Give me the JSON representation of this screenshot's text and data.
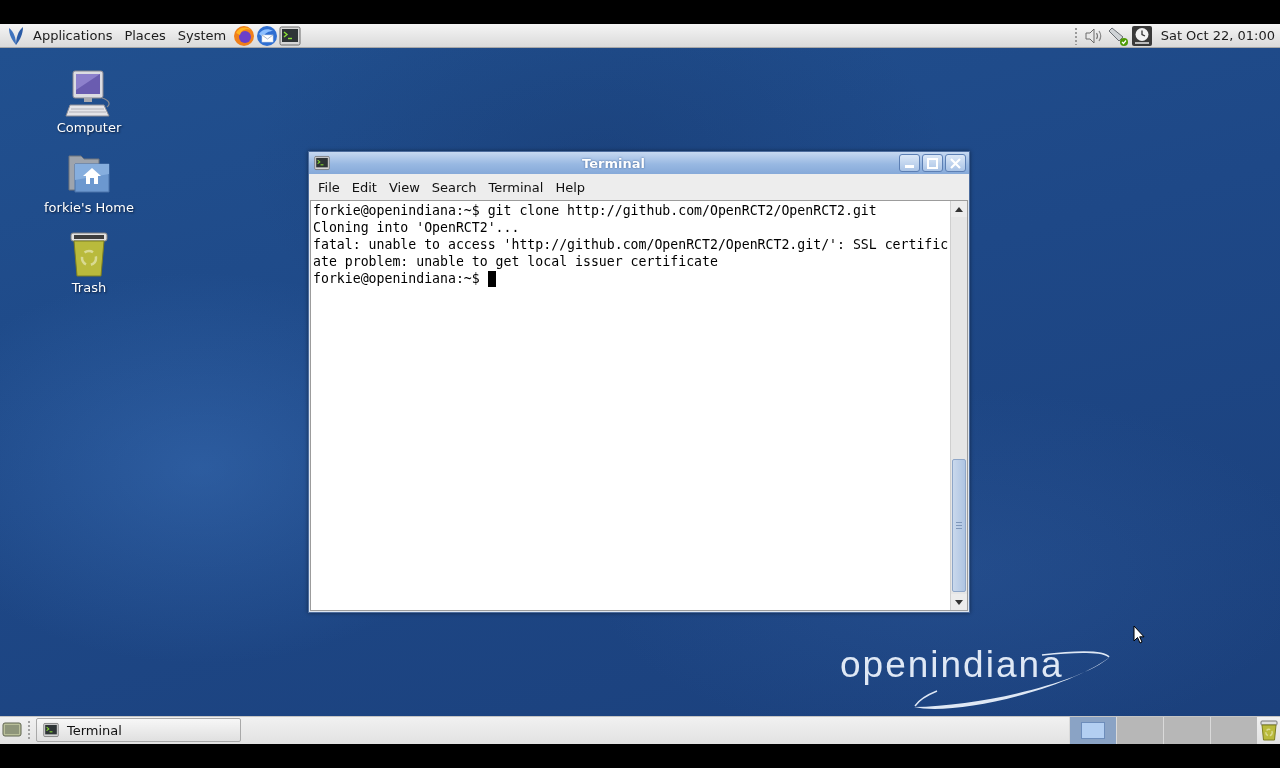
{
  "top_panel": {
    "menus": [
      "Applications",
      "Places",
      "System"
    ],
    "clock": "Sat Oct 22, 01:00"
  },
  "desktop_icons": [
    {
      "kind": "computer",
      "label": "Computer"
    },
    {
      "kind": "home",
      "label": "forkie's Home"
    },
    {
      "kind": "trash",
      "label": "Trash"
    }
  ],
  "window": {
    "title": "Terminal",
    "menu": [
      "File",
      "Edit",
      "View",
      "Search",
      "Terminal",
      "Help"
    ],
    "lines": [
      {
        "text": "forkie@openindiana:~$ git clone http://github.com/OpenRCT2/OpenRCT2.git",
        "cursor": false
      },
      {
        "text": "Cloning into 'OpenRCT2'...",
        "cursor": false
      },
      {
        "text": "fatal: unable to access 'http://github.com/OpenRCT2/OpenRCT2.git/': SSL certific",
        "cursor": false
      },
      {
        "text": "ate problem: unable to get local issuer certificate",
        "cursor": false
      },
      {
        "text": "forkie@openindiana:~$",
        "cursor": true
      }
    ]
  },
  "wallpaper": {
    "logo": "openindiana"
  },
  "bottom_panel": {
    "tasks": [
      {
        "label": "Terminal",
        "selected": false
      }
    ],
    "workspaces": [
      {
        "selected": true,
        "has_window": true
      },
      {
        "selected": false,
        "has_window": false
      },
      {
        "selected": false,
        "has_window": false
      },
      {
        "selected": false,
        "has_window": false
      }
    ]
  }
}
